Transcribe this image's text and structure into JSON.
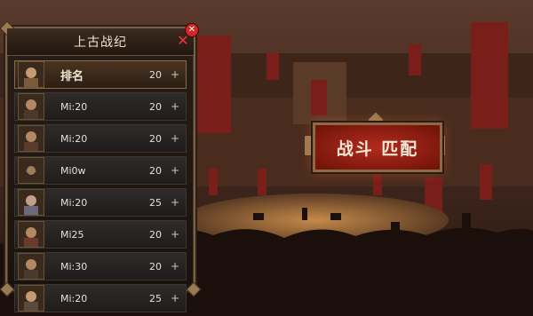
{
  "panel": {
    "title": "上古战纪",
    "close_badge": "✕",
    "rows": [
      {
        "name": "排名",
        "score": "20",
        "plus": "+"
      },
      {
        "name": "Mi:20",
        "score": "20",
        "plus": "+"
      },
      {
        "name": "Mi:20",
        "score": "20",
        "plus": "+"
      },
      {
        "name": "Mi0w",
        "score": "20",
        "plus": "+"
      },
      {
        "name": "Mi:20",
        "score": "25",
        "plus": "+"
      },
      {
        "name": "Mi25",
        "score": "20",
        "plus": "+"
      },
      {
        "name": "Mi:30",
        "score": "20",
        "plus": "+"
      },
      {
        "name": "Mi:20",
        "score": "25",
        "plus": "+"
      }
    ]
  },
  "match_button": {
    "label": "战斗 匹配"
  },
  "colors": {
    "accent": "#b32b1d",
    "frame": "#8c6a44"
  }
}
